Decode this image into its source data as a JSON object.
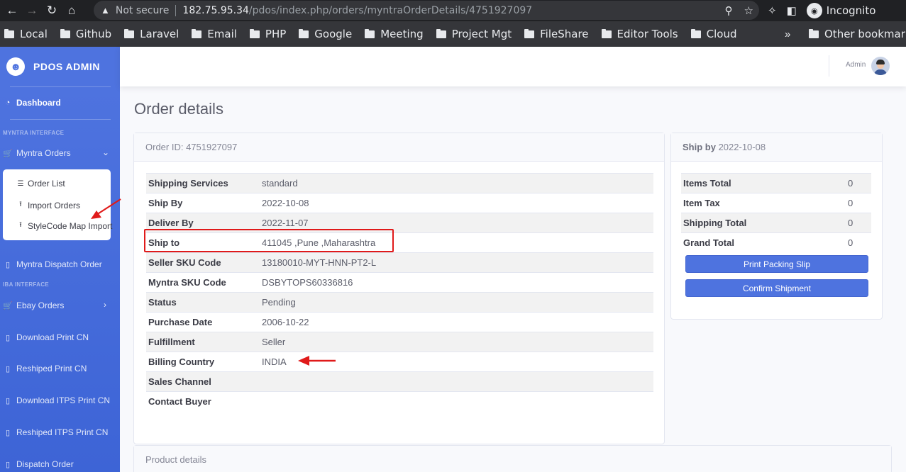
{
  "browser": {
    "security_label": "Not secure",
    "url_host": "182.75.95.34",
    "url_path": "/pdos/index.php/orders/myntraOrderDetails/4751927097",
    "profile_label": "Incognito",
    "profile_icon": "incognito-icon",
    "bookmarks": [
      "Local",
      "Github",
      "Laravel",
      "Email",
      "PHP",
      "Google",
      "Meeting",
      "Project Mgt",
      "FileShare",
      "Editor Tools",
      "Cloud"
    ],
    "bookmarks_more": "»",
    "other_bookmarks": "Other bookmarks"
  },
  "sidebar": {
    "brand": "PDOS ADMIN",
    "dashboard": "Dashboard",
    "section_myntra": "MYNTRA INTERFACE",
    "myntra_orders": "Myntra Orders",
    "submenu": {
      "order_list": "Order List",
      "import_orders": "Import Orders",
      "stylecode_import": "StyleCode Map Import"
    },
    "myntra_dispatch": "Myntra Dispatch Order",
    "section_iba": "IBA INTERFACE",
    "ebay_orders": "Ebay Orders",
    "download_print_cn": "Download Print CN",
    "reshiped_print_cn": "Reshiped Print CN",
    "download_itps": "Download ITPS Print CN",
    "reshiped_itps": "Reshiped ITPS Print CN",
    "dispatch_order": "Dispatch Order"
  },
  "topbar": {
    "user_name": "Admin"
  },
  "page": {
    "title": "Order details"
  },
  "order_card": {
    "header": "Order ID: 4751927097",
    "rows": [
      {
        "label": "Shipping Services",
        "value": "standard"
      },
      {
        "label": "Ship By",
        "value": "2022-10-08"
      },
      {
        "label": "Deliver By",
        "value": "2022-11-07"
      },
      {
        "label": "Ship to",
        "value": "411045 ,Pune ,Maharashtra"
      },
      {
        "label": "Seller SKU Code",
        "value": "13180010-MYT-HNN-PT2-L"
      },
      {
        "label": "Myntra SKU Code",
        "value": "DSBYTOPS60336816"
      },
      {
        "label": "Status",
        "value": "Pending"
      },
      {
        "label": "Purchase Date",
        "value": "2006-10-22"
      },
      {
        "label": "Fulfillment",
        "value": "Seller"
      },
      {
        "label": "Billing Country",
        "value": "INDIA"
      },
      {
        "label": "Sales Channel",
        "value": ""
      },
      {
        "label": "Contact Buyer",
        "value": ""
      }
    ]
  },
  "ship_card": {
    "header_label": "Ship by",
    "header_date": "2022-10-08",
    "rows": [
      {
        "label": "Items Total",
        "value": "0"
      },
      {
        "label": "Item Tax",
        "value": "0"
      },
      {
        "label": "Shipping Total",
        "value": "0"
      },
      {
        "label": "Grand Total",
        "value": "0"
      }
    ],
    "print_button": "Print Packing Slip",
    "confirm_button": "Confirm Shipment"
  },
  "product_card": {
    "header": "Product details"
  },
  "annotation_color": "#e01a1a",
  "brand_color": "#4e73df"
}
